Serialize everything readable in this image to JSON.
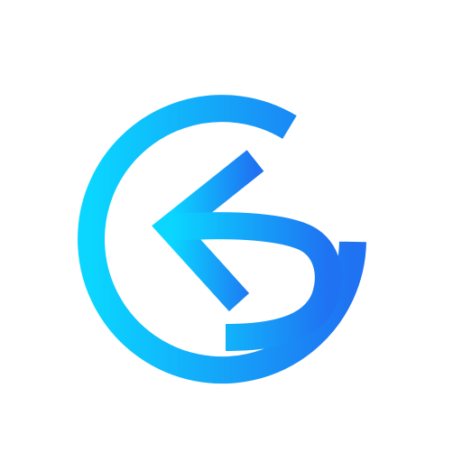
{
  "image": {
    "background_color": "#ffffff",
    "subject": "back-arrow-circle-logo-icon",
    "gradient": {
      "start_color": "#0ad6ff",
      "end_color": "#1f72f2"
    }
  }
}
